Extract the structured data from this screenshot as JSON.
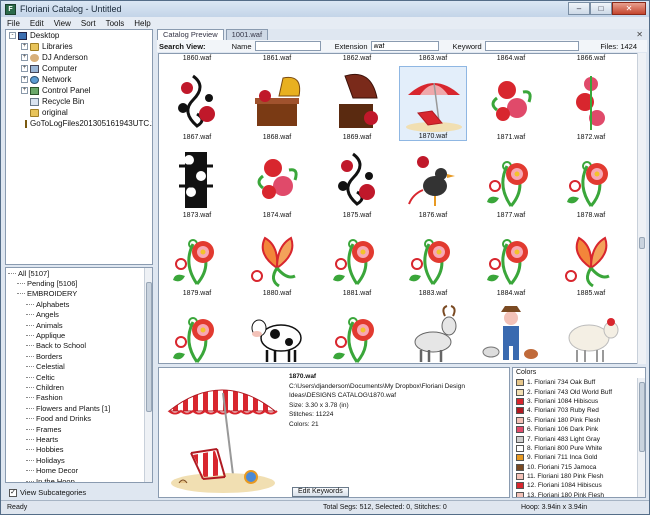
{
  "window": {
    "title": "Floriani Catalog - Untitled",
    "min": "–",
    "max": "□",
    "close": "✕"
  },
  "menu": [
    "File",
    "Edit",
    "View",
    "Sort",
    "Tools",
    "Help"
  ],
  "tree": [
    {
      "label": "Desktop",
      "icon": "desktop-icon",
      "level": 0,
      "exp": "-"
    },
    {
      "label": "Libraries",
      "icon": "folder-icon",
      "level": 1,
      "exp": "+"
    },
    {
      "label": "DJ Anderson",
      "icon": "user-folder-icon",
      "level": 1,
      "exp": "+"
    },
    {
      "label": "Computer",
      "icon": "computer-icon",
      "level": 1,
      "exp": "+"
    },
    {
      "label": "Network",
      "icon": "network-icon",
      "level": 1,
      "exp": "+"
    },
    {
      "label": "Control Panel",
      "icon": "control-panel-icon",
      "level": 1,
      "exp": "+"
    },
    {
      "label": "Recycle Bin",
      "icon": "recycle-bin-icon",
      "level": 1,
      "exp": ""
    },
    {
      "label": "original",
      "icon": "folder-icon",
      "level": 1,
      "exp": ""
    },
    {
      "label": "GoToLogFiles201305161943UTC.zip",
      "icon": "zip-icon",
      "level": 1,
      "exp": ""
    }
  ],
  "categories": [
    {
      "label": "All [5107]",
      "level": 0
    },
    {
      "label": "Pending [5106]",
      "level": 1
    },
    {
      "label": "EMBROIDERY",
      "level": 1
    },
    {
      "label": "Alphabets",
      "level": 2
    },
    {
      "label": "Angels",
      "level": 2
    },
    {
      "label": "Animals",
      "level": 2
    },
    {
      "label": "Applique",
      "level": 2
    },
    {
      "label": "Back to School",
      "level": 2
    },
    {
      "label": "Borders",
      "level": 2
    },
    {
      "label": "Celestial",
      "level": 2
    },
    {
      "label": "Celtic",
      "level": 2
    },
    {
      "label": "Children",
      "level": 2
    },
    {
      "label": "Fashion",
      "level": 2
    },
    {
      "label": "Flowers and Plants [1]",
      "level": 2
    },
    {
      "label": "Food and Drinks",
      "level": 2
    },
    {
      "label": "Frames",
      "level": 2
    },
    {
      "label": "Hearts",
      "level": 2
    },
    {
      "label": "Hobbies",
      "level": 2
    },
    {
      "label": "Holidays",
      "level": 2
    },
    {
      "label": "Home Decor",
      "level": 2
    },
    {
      "label": "In the Hoop",
      "level": 2
    },
    {
      "label": "Nature",
      "level": 2
    },
    {
      "label": "Nursery",
      "level": 2
    },
    {
      "label": "Patriotic",
      "level": 2
    },
    {
      "label": "Quilting Designs",
      "level": 2
    }
  ],
  "view_subcategories": {
    "label": "View Subcategories",
    "checked": true
  },
  "tabs": [
    "Catalog Preview",
    "1001.waf"
  ],
  "search": {
    "label": "Search View:",
    "name_label": "Name",
    "name_value": "",
    "ext_label": "Extension",
    "ext_value": "waf",
    "keyword_label": "Keyword",
    "keyword_value": "",
    "files": "Files: 1424"
  },
  "grid": {
    "top_labels": [
      "1860.waf",
      "1861.waf",
      "1862.waf",
      "1863.waf",
      "1864.waf",
      "1866.waf"
    ],
    "rows": [
      [
        {
          "file": "1867.waf",
          "motif": "music"
        },
        {
          "file": "1868.waf",
          "motif": "phonograph"
        },
        {
          "file": "1869.waf",
          "motif": "phonograph2"
        },
        {
          "file": "1870.waf",
          "motif": "beach",
          "selected": true
        },
        {
          "file": "1871.waf",
          "motif": "roses"
        },
        {
          "file": "1872.waf",
          "motif": "roses2"
        }
      ],
      [
        {
          "file": "1873.waf",
          "motif": "skull"
        },
        {
          "file": "1874.waf",
          "motif": "roses"
        },
        {
          "file": "1875.waf",
          "motif": "music"
        },
        {
          "file": "1876.waf",
          "motif": "bird"
        },
        {
          "file": "1877.waf",
          "motif": "flower"
        },
        {
          "file": "1878.waf",
          "motif": "flower"
        }
      ],
      [
        {
          "file": "1879.waf",
          "motif": "flower"
        },
        {
          "file": "1880.waf",
          "motif": "butterfly"
        },
        {
          "file": "1881.waf",
          "motif": "flower"
        },
        {
          "file": "1883.waf",
          "motif": "flower"
        },
        {
          "file": "1884.waf",
          "motif": "flower"
        },
        {
          "file": "1885.waf",
          "motif": "butterfly"
        }
      ],
      [
        {
          "file": "",
          "motif": "flower"
        },
        {
          "file": "",
          "motif": "cow"
        },
        {
          "file": "",
          "motif": "flower"
        },
        {
          "file": "",
          "motif": "goat"
        },
        {
          "file": "",
          "motif": "farmer"
        },
        {
          "file": "",
          "motif": "sheep"
        }
      ]
    ]
  },
  "details": {
    "filename": "1870.waf",
    "path": "C:\\Users\\djanderson\\Documents\\My Dropbox\\Floriani Design Ideas\\DESIGNS CATALOG\\1870.waf",
    "size": "Size: 3.30 x 3.78 (in)",
    "stitches": "Stitches: 11224",
    "colors": "Colors: 21",
    "edit_button": "Edit Keywords"
  },
  "colors": {
    "title": "Colors",
    "list": [
      {
        "label": "1. Floriani 734 Oak Buff",
        "hex": "#e6c68a"
      },
      {
        "label": "2. Floriani 743 Old World Buff",
        "hex": "#f1dfb2"
      },
      {
        "label": "3. Floriani 1084 Hibiscus",
        "hex": "#d8262e"
      },
      {
        "label": "4. Floriani 703 Ruby Red",
        "hex": "#b01a22"
      },
      {
        "label": "5. Floriani 180 Pink Flesh",
        "hex": "#f3c2b8"
      },
      {
        "label": "6. Floriani 106 Dark Pink",
        "hex": "#e04a6a"
      },
      {
        "label": "7. Floriani 483 Light Gray",
        "hex": "#cfcfcf"
      },
      {
        "label": "8. Floriani 800 Pure White",
        "hex": "#ffffff"
      },
      {
        "label": "9. Floriani 711 Inca Gold",
        "hex": "#e89a22"
      },
      {
        "label": "10. Floriani 715 Jamoca",
        "hex": "#7a4a22"
      },
      {
        "label": "11. Floriani 180 Pink Flesh",
        "hex": "#f3c2b8"
      },
      {
        "label": "12. Floriani 1084 Hibiscus",
        "hex": "#d8262e"
      },
      {
        "label": "13. Floriani 180 Pink Flesh",
        "hex": "#f3c2b8"
      }
    ]
  },
  "status": {
    "ready": "Ready",
    "segs": "Total Segs: 512, Selected: 0, Stitches: 0",
    "hoop": "Hoop: 3.94in x 3.94in"
  }
}
